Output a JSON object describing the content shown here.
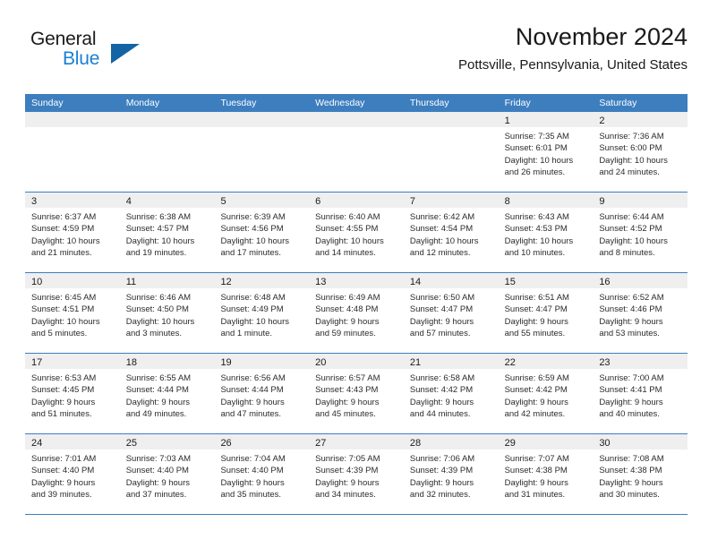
{
  "brand": {
    "line1": "General",
    "line2": "Blue",
    "triangle_color": "#1464a5",
    "blue_color": "#1b7fd4"
  },
  "header": {
    "title": "November 2024",
    "subtitle": "Pottsville, Pennsylvania, United States"
  },
  "theme": {
    "header_blue": "#3d7ebf",
    "daynum_band": "#efefef",
    "text": "#1a1a1a"
  },
  "weekdays": [
    "Sunday",
    "Monday",
    "Tuesday",
    "Wednesday",
    "Thursday",
    "Friday",
    "Saturday"
  ],
  "labels": {
    "sunrise_prefix": "Sunrise: ",
    "sunset_prefix": "Sunset: ",
    "daylight_prefix": "Daylight: "
  },
  "weeks": [
    [
      {
        "day": "",
        "sunrise": "",
        "sunset": "",
        "daylight_l1": "",
        "daylight_l2": "",
        "empty": true
      },
      {
        "day": "",
        "sunrise": "",
        "sunset": "",
        "daylight_l1": "",
        "daylight_l2": "",
        "empty": true
      },
      {
        "day": "",
        "sunrise": "",
        "sunset": "",
        "daylight_l1": "",
        "daylight_l2": "",
        "empty": true
      },
      {
        "day": "",
        "sunrise": "",
        "sunset": "",
        "daylight_l1": "",
        "daylight_l2": "",
        "empty": true
      },
      {
        "day": "",
        "sunrise": "",
        "sunset": "",
        "daylight_l1": "",
        "daylight_l2": "",
        "empty": true
      },
      {
        "day": "1",
        "sunrise": "Sunrise: 7:35 AM",
        "sunset": "Sunset: 6:01 PM",
        "daylight_l1": "Daylight: 10 hours",
        "daylight_l2": "and 26 minutes.",
        "empty": false
      },
      {
        "day": "2",
        "sunrise": "Sunrise: 7:36 AM",
        "sunset": "Sunset: 6:00 PM",
        "daylight_l1": "Daylight: 10 hours",
        "daylight_l2": "and 24 minutes.",
        "empty": false
      }
    ],
    [
      {
        "day": "3",
        "sunrise": "Sunrise: 6:37 AM",
        "sunset": "Sunset: 4:59 PM",
        "daylight_l1": "Daylight: 10 hours",
        "daylight_l2": "and 21 minutes.",
        "empty": false
      },
      {
        "day": "4",
        "sunrise": "Sunrise: 6:38 AM",
        "sunset": "Sunset: 4:57 PM",
        "daylight_l1": "Daylight: 10 hours",
        "daylight_l2": "and 19 minutes.",
        "empty": false
      },
      {
        "day": "5",
        "sunrise": "Sunrise: 6:39 AM",
        "sunset": "Sunset: 4:56 PM",
        "daylight_l1": "Daylight: 10 hours",
        "daylight_l2": "and 17 minutes.",
        "empty": false
      },
      {
        "day": "6",
        "sunrise": "Sunrise: 6:40 AM",
        "sunset": "Sunset: 4:55 PM",
        "daylight_l1": "Daylight: 10 hours",
        "daylight_l2": "and 14 minutes.",
        "empty": false
      },
      {
        "day": "7",
        "sunrise": "Sunrise: 6:42 AM",
        "sunset": "Sunset: 4:54 PM",
        "daylight_l1": "Daylight: 10 hours",
        "daylight_l2": "and 12 minutes.",
        "empty": false
      },
      {
        "day": "8",
        "sunrise": "Sunrise: 6:43 AM",
        "sunset": "Sunset: 4:53 PM",
        "daylight_l1": "Daylight: 10 hours",
        "daylight_l2": "and 10 minutes.",
        "empty": false
      },
      {
        "day": "9",
        "sunrise": "Sunrise: 6:44 AM",
        "sunset": "Sunset: 4:52 PM",
        "daylight_l1": "Daylight: 10 hours",
        "daylight_l2": "and 8 minutes.",
        "empty": false
      }
    ],
    [
      {
        "day": "10",
        "sunrise": "Sunrise: 6:45 AM",
        "sunset": "Sunset: 4:51 PM",
        "daylight_l1": "Daylight: 10 hours",
        "daylight_l2": "and 5 minutes.",
        "empty": false
      },
      {
        "day": "11",
        "sunrise": "Sunrise: 6:46 AM",
        "sunset": "Sunset: 4:50 PM",
        "daylight_l1": "Daylight: 10 hours",
        "daylight_l2": "and 3 minutes.",
        "empty": false
      },
      {
        "day": "12",
        "sunrise": "Sunrise: 6:48 AM",
        "sunset": "Sunset: 4:49 PM",
        "daylight_l1": "Daylight: 10 hours",
        "daylight_l2": "and 1 minute.",
        "empty": false
      },
      {
        "day": "13",
        "sunrise": "Sunrise: 6:49 AM",
        "sunset": "Sunset: 4:48 PM",
        "daylight_l1": "Daylight: 9 hours",
        "daylight_l2": "and 59 minutes.",
        "empty": false
      },
      {
        "day": "14",
        "sunrise": "Sunrise: 6:50 AM",
        "sunset": "Sunset: 4:47 PM",
        "daylight_l1": "Daylight: 9 hours",
        "daylight_l2": "and 57 minutes.",
        "empty": false
      },
      {
        "day": "15",
        "sunrise": "Sunrise: 6:51 AM",
        "sunset": "Sunset: 4:47 PM",
        "daylight_l1": "Daylight: 9 hours",
        "daylight_l2": "and 55 minutes.",
        "empty": false
      },
      {
        "day": "16",
        "sunrise": "Sunrise: 6:52 AM",
        "sunset": "Sunset: 4:46 PM",
        "daylight_l1": "Daylight: 9 hours",
        "daylight_l2": "and 53 minutes.",
        "empty": false
      }
    ],
    [
      {
        "day": "17",
        "sunrise": "Sunrise: 6:53 AM",
        "sunset": "Sunset: 4:45 PM",
        "daylight_l1": "Daylight: 9 hours",
        "daylight_l2": "and 51 minutes.",
        "empty": false
      },
      {
        "day": "18",
        "sunrise": "Sunrise: 6:55 AM",
        "sunset": "Sunset: 4:44 PM",
        "daylight_l1": "Daylight: 9 hours",
        "daylight_l2": "and 49 minutes.",
        "empty": false
      },
      {
        "day": "19",
        "sunrise": "Sunrise: 6:56 AM",
        "sunset": "Sunset: 4:44 PM",
        "daylight_l1": "Daylight: 9 hours",
        "daylight_l2": "and 47 minutes.",
        "empty": false
      },
      {
        "day": "20",
        "sunrise": "Sunrise: 6:57 AM",
        "sunset": "Sunset: 4:43 PM",
        "daylight_l1": "Daylight: 9 hours",
        "daylight_l2": "and 45 minutes.",
        "empty": false
      },
      {
        "day": "21",
        "sunrise": "Sunrise: 6:58 AM",
        "sunset": "Sunset: 4:42 PM",
        "daylight_l1": "Daylight: 9 hours",
        "daylight_l2": "and 44 minutes.",
        "empty": false
      },
      {
        "day": "22",
        "sunrise": "Sunrise: 6:59 AM",
        "sunset": "Sunset: 4:42 PM",
        "daylight_l1": "Daylight: 9 hours",
        "daylight_l2": "and 42 minutes.",
        "empty": false
      },
      {
        "day": "23",
        "sunrise": "Sunrise: 7:00 AM",
        "sunset": "Sunset: 4:41 PM",
        "daylight_l1": "Daylight: 9 hours",
        "daylight_l2": "and 40 minutes.",
        "empty": false
      }
    ],
    [
      {
        "day": "24",
        "sunrise": "Sunrise: 7:01 AM",
        "sunset": "Sunset: 4:40 PM",
        "daylight_l1": "Daylight: 9 hours",
        "daylight_l2": "and 39 minutes.",
        "empty": false
      },
      {
        "day": "25",
        "sunrise": "Sunrise: 7:03 AM",
        "sunset": "Sunset: 4:40 PM",
        "daylight_l1": "Daylight: 9 hours",
        "daylight_l2": "and 37 minutes.",
        "empty": false
      },
      {
        "day": "26",
        "sunrise": "Sunrise: 7:04 AM",
        "sunset": "Sunset: 4:40 PM",
        "daylight_l1": "Daylight: 9 hours",
        "daylight_l2": "and 35 minutes.",
        "empty": false
      },
      {
        "day": "27",
        "sunrise": "Sunrise: 7:05 AM",
        "sunset": "Sunset: 4:39 PM",
        "daylight_l1": "Daylight: 9 hours",
        "daylight_l2": "and 34 minutes.",
        "empty": false
      },
      {
        "day": "28",
        "sunrise": "Sunrise: 7:06 AM",
        "sunset": "Sunset: 4:39 PM",
        "daylight_l1": "Daylight: 9 hours",
        "daylight_l2": "and 32 minutes.",
        "empty": false
      },
      {
        "day": "29",
        "sunrise": "Sunrise: 7:07 AM",
        "sunset": "Sunset: 4:38 PM",
        "daylight_l1": "Daylight: 9 hours",
        "daylight_l2": "and 31 minutes.",
        "empty": false
      },
      {
        "day": "30",
        "sunrise": "Sunrise: 7:08 AM",
        "sunset": "Sunset: 4:38 PM",
        "daylight_l1": "Daylight: 9 hours",
        "daylight_l2": "and 30 minutes.",
        "empty": false
      }
    ]
  ]
}
